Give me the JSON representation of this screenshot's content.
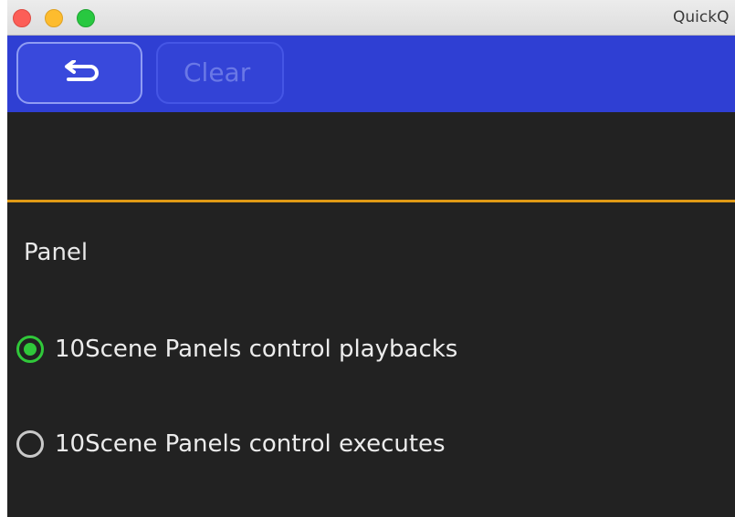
{
  "window": {
    "title": "QuickQ"
  },
  "toolbar": {
    "back_icon": "return-arrow-icon",
    "clear_label": "Clear"
  },
  "panel": {
    "section_label": "Panel",
    "options": [
      {
        "label": "10Scene Panels control playbacks",
        "selected": true
      },
      {
        "label": "10Scene Panels control executes",
        "selected": false
      }
    ]
  },
  "colors": {
    "toolbar_bg": "#2f3fd3",
    "accent_separator": "#e09a16",
    "radio_selected": "#30c83a",
    "content_bg": "#222222"
  }
}
